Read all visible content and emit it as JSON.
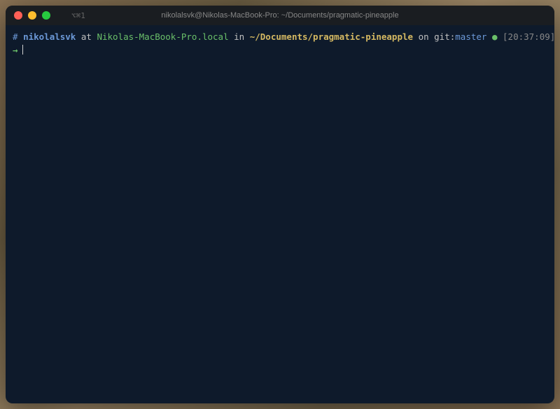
{
  "window": {
    "title": "nikolalsvk@Nikolas-MacBook-Pro: ~/Documents/pragmatic-pineapple",
    "shortcut": "⌥⌘1"
  },
  "prompt": {
    "hash": "#",
    "username": "nikolalsvk",
    "at": "at",
    "hostname": "Nikolas-MacBook-Pro.local",
    "in": "in",
    "path": "~/Documents/pragmatic-pineapple",
    "on": "on",
    "git_label": "git:",
    "git_branch": "master",
    "status_dot": "●",
    "timestamp": "[20:37:09]"
  },
  "input": {
    "arrow": "→",
    "value": ""
  }
}
